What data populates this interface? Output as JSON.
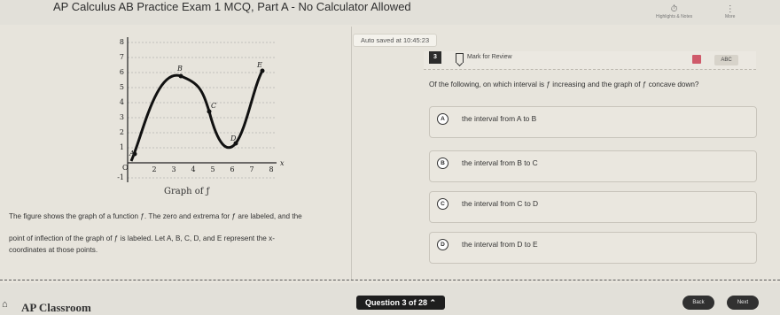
{
  "header": {
    "exam_title": "AP Calculus AB Practice Exam 1 MCQ, Part A - No Calculator Allowed",
    "tools": [
      {
        "icon": "timer-icon",
        "label": "Highlights & Notes"
      },
      {
        "icon": "more-icon",
        "label": "More"
      }
    ]
  },
  "status": {
    "saved_text": "Auto saved at 10:45:23"
  },
  "question": {
    "number": "3",
    "mark_label": "Mark for Review",
    "abc_label": "ABC",
    "prompt": "Of the following, on which interval is ƒ increasing and the graph of ƒ concave down?",
    "choices": [
      {
        "letter": "A",
        "text": "the interval from A to B"
      },
      {
        "letter": "B",
        "text": "the interval from B to C"
      },
      {
        "letter": "C",
        "text": "the interval from C to D"
      },
      {
        "letter": "D",
        "text": "the interval from D to E"
      }
    ]
  },
  "stimulus": {
    "graph_caption": "Graph of ƒ",
    "paragraph1": "The figure shows the graph of a function ƒ. The zero and extrema for ƒ are labeled, and the",
    "paragraph2": "point of inflection of the graph of ƒ is labeled. Let A, B, C, D, and E represent the x-",
    "paragraph3": "coordinates at those points.",
    "x_axis_label": "x",
    "y_ticks": [
      "-1",
      "1",
      "2",
      "3",
      "4",
      "5",
      "6",
      "7",
      "8"
    ],
    "x_ticks": [
      "2",
      "3",
      "4",
      "5",
      "6",
      "7",
      "8"
    ],
    "origin_label": "O",
    "point_labels": [
      "A",
      "B",
      "C",
      "D",
      "E"
    ]
  },
  "footer": {
    "brand": "AP Classroom",
    "question_nav": "Question 3 of 28",
    "back_label": "Back",
    "next_label": "Next"
  }
}
